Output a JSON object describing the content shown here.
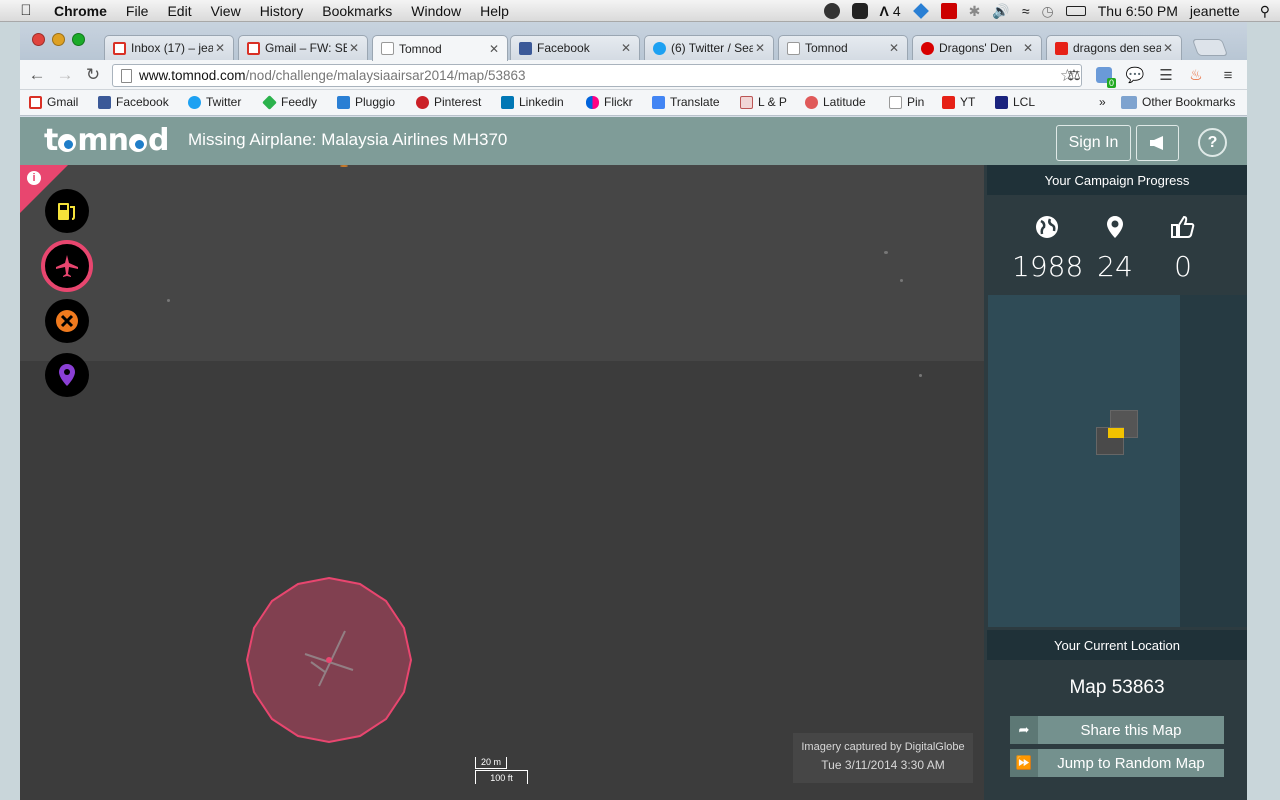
{
  "menubar": {
    "app": "Chrome",
    "items": [
      "File",
      "Edit",
      "View",
      "History",
      "Bookmarks",
      "Window",
      "Help"
    ],
    "adobe_count": "4",
    "clock": "Thu 6:50 PM",
    "user": "jeanette"
  },
  "tabs": [
    {
      "label": "Inbox (17) – jea",
      "icon": "gmail-icon",
      "color": "#d93025"
    },
    {
      "label": "Gmail – FW: SEE",
      "icon": "gmail-icon",
      "color": "#d93025"
    },
    {
      "label": "Tomnod",
      "icon": "page-icon",
      "color": "#ffffff"
    },
    {
      "label": "Facebook",
      "icon": "facebook-icon",
      "color": "#3b5998"
    },
    {
      "label": "(6) Twitter / Sea",
      "icon": "twitter-icon",
      "color": "#1da1f2"
    },
    {
      "label": "Tomnod",
      "icon": "page-icon",
      "color": "#ffffff"
    },
    {
      "label": "Dragons' Den",
      "icon": "cbc-icon",
      "color": "#d80000"
    },
    {
      "label": "dragons den sea",
      "icon": "youtube-icon",
      "color": "#e62117"
    }
  ],
  "omnibox": {
    "host": "www.tomnod.com",
    "path": "/nod/challenge/malaysiaairsar2014/map/53863"
  },
  "extensions": {
    "badge": "0"
  },
  "bookmarks": [
    {
      "label": "Gmail",
      "icon": "gmail-icon",
      "color": "#d93025"
    },
    {
      "label": "Facebook",
      "icon": "facebook-icon",
      "color": "#3b5998"
    },
    {
      "label": "Twitter",
      "icon": "twitter-icon",
      "color": "#1da1f2"
    },
    {
      "label": "Feedly",
      "icon": "feedly-icon",
      "color": "#2bb24c"
    },
    {
      "label": "Pluggio",
      "icon": "pluggio-icon",
      "color": "#2a7fd4"
    },
    {
      "label": "Pinterest",
      "icon": "pinterest-icon",
      "color": "#cb2027"
    },
    {
      "label": "Linkedin",
      "icon": "linkedin-icon",
      "color": "#0077b5"
    },
    {
      "label": "Flickr",
      "icon": "flickr-icon",
      "color": "#ff0084"
    },
    {
      "label": "Translate",
      "icon": "translate-icon",
      "color": "#4285f4"
    },
    {
      "label": "L & P",
      "icon": "lp-icon",
      "color": "#b55"
    },
    {
      "label": "Latitude",
      "icon": "latitude-icon",
      "color": "#e05a5a"
    },
    {
      "label": "Pin",
      "icon": "page-icon",
      "color": "#ffffff"
    },
    {
      "label": "YT",
      "icon": "youtube-icon",
      "color": "#e62117"
    },
    {
      "label": "LCL",
      "icon": "lcl-icon",
      "color": "#1a237e"
    }
  ],
  "bookmarks_more": "»",
  "other_bookmarks": "Other Bookmarks",
  "tomnod": {
    "logo": "tomnod",
    "title": "Missing Airplane: Malaysia Airlines MH370",
    "sign_in": "Sign In",
    "help": "?"
  },
  "tools": [
    {
      "name": "fuel-tool",
      "icon": "fuel-icon",
      "color": "#f5e23a"
    },
    {
      "name": "airplane-tool",
      "icon": "airplane-icon",
      "color": "#e8466f"
    },
    {
      "name": "damage-tool",
      "icon": "x-circle-icon",
      "color": "#f07a1e"
    },
    {
      "name": "pin-tool",
      "icon": "map-pin-icon",
      "color": "#8a3fd4"
    }
  ],
  "map": {
    "scale_top": "20 m",
    "scale_bottom": "100 ft",
    "credit": "Imagery captured by DigitalGlobe",
    "date": "Tue 3/11/2014 3:30 AM",
    "marker_color": "#e8466f"
  },
  "sidebar": {
    "progress_title": "Your Campaign Progress",
    "stats": [
      {
        "icon": "globe-icon",
        "value": "1988"
      },
      {
        "icon": "map-marker-icon",
        "value": "24"
      },
      {
        "icon": "thumbs-up-icon",
        "value": "0"
      }
    ],
    "location_title": "Your Current Location",
    "location": "Map 53863",
    "share": "Share this Map",
    "jump": "Jump to Random Map"
  }
}
